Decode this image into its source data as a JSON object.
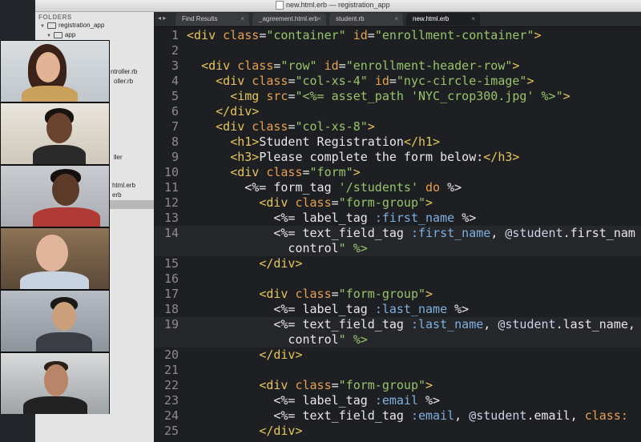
{
  "window": {
    "title": "new.html.erb — registration_app"
  },
  "sidebar": {
    "header": "FOLDERS",
    "items": [
      {
        "label": "registration_app",
        "kind": "folder"
      },
      {
        "label": "app",
        "kind": "folder"
      },
      {
        "label": "ntroller.rb",
        "kind": "file"
      },
      {
        "label": "oller.rb",
        "kind": "file"
      },
      {
        "label": "ller",
        "kind": "file"
      },
      {
        "label": "html.erb",
        "kind": "file"
      },
      {
        "label": "erb",
        "kind": "file"
      }
    ]
  },
  "tabs": [
    {
      "label": "Find Results",
      "active": false
    },
    {
      "label": "_agreement.html.erb",
      "active": false
    },
    {
      "label": "student.rb",
      "active": false
    },
    {
      "label": "new.html.erb",
      "active": true
    }
  ],
  "tab_close_glyph": "×",
  "tab_nav": "◂ ▸",
  "editor": {
    "lines": [
      {
        "n": "1",
        "t": "<div class=\"container\" id=\"enrollment-container\">"
      },
      {
        "n": "2",
        "t": ""
      },
      {
        "n": "3",
        "t": "  <div class=\"row\" id=\"enrollment-header-row\">"
      },
      {
        "n": "4",
        "t": "    <div class=\"col-xs-4\" id=\"nyc-circle-image\">"
      },
      {
        "n": "5",
        "t": "      <img src=\"<%= asset_path 'NYC_crop300.jpg' %>\">"
      },
      {
        "n": "6",
        "t": "    </div>"
      },
      {
        "n": "7",
        "t": "    <div class=\"col-xs-8\">"
      },
      {
        "n": "8",
        "t": "      <h1>Student Registration</h1>"
      },
      {
        "n": "9",
        "t": "      <h3>Please complete the form below:</h3>"
      },
      {
        "n": "10",
        "t": "      <div class=\"form\">"
      },
      {
        "n": "11",
        "t": "        <%= form_tag '/students' do %>"
      },
      {
        "n": "12",
        "t": "          <div class=\"form-group\">"
      },
      {
        "n": "13",
        "t": "            <%= label_tag :first_name %>"
      },
      {
        "n": "14",
        "t": "            <%= text_field_tag :first_name, @student.first_nam"
      },
      {
        "n": "",
        "t": "              control\" %>"
      },
      {
        "n": "15",
        "t": "          </div>"
      },
      {
        "n": "16",
        "t": ""
      },
      {
        "n": "17",
        "t": "          <div class=\"form-group\">"
      },
      {
        "n": "18",
        "t": "            <%= label_tag :last_name %>"
      },
      {
        "n": "19",
        "t": "            <%= text_field_tag :last_name, @student.last_name,"
      },
      {
        "n": "",
        "t": "              control\" %>"
      },
      {
        "n": "20",
        "t": "          </div>"
      },
      {
        "n": "21",
        "t": ""
      },
      {
        "n": "22",
        "t": "          <div class=\"form-group\">"
      },
      {
        "n": "23",
        "t": "            <%= label_tag :email %>"
      },
      {
        "n": "24",
        "t": "            <%= text_field_tag :email, @student.email, class:"
      },
      {
        "n": "25",
        "t": "          </div>"
      }
    ]
  },
  "video_participants": [
    {
      "name": "participant-1"
    },
    {
      "name": "participant-2"
    },
    {
      "name": "participant-3"
    },
    {
      "name": "participant-4"
    },
    {
      "name": "participant-5"
    },
    {
      "name": "participant-6"
    }
  ],
  "colors": {
    "editor_bg": "#1e1f22",
    "tag": "#e6c65a",
    "string": "#97c46a",
    "symbol": "#7fb0df",
    "keyword": "#e5a050"
  }
}
